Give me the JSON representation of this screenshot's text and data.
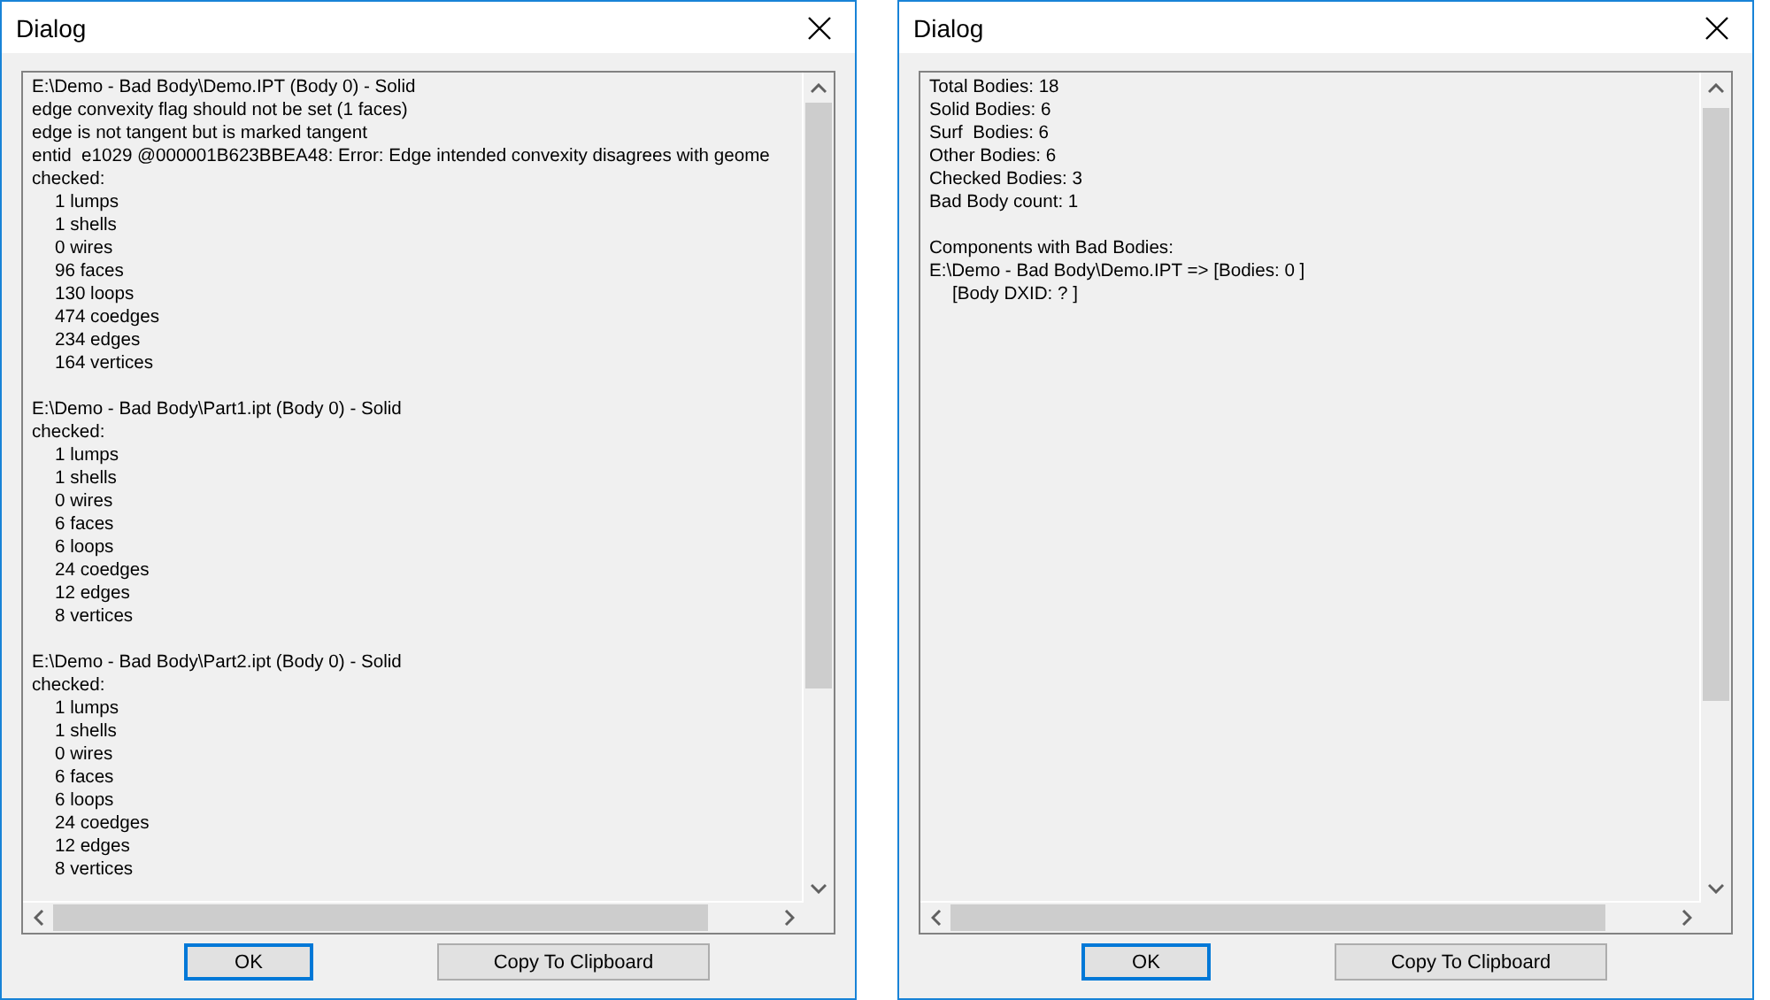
{
  "dialogs": [
    {
      "title": "Dialog",
      "blocks": [
        {
          "lines": [
            {
              "text": "E:\\Demo - Bad Body\\Demo.IPT (Body 0) - Solid"
            },
            {
              "text": "edge convexity flag should not be set (1 faces)"
            },
            {
              "text": "edge is not tangent but is marked tangent"
            },
            {
              "text": "entid  e1029 @000001B623BBEA48: Error: Edge intended convexity disagrees with geome"
            },
            {
              "text": "checked:",
              "children": [
                {
                  "text": "1 lumps"
                },
                {
                  "text": "1 shells"
                },
                {
                  "text": "0 wires"
                },
                {
                  "text": "96 faces"
                },
                {
                  "text": "130 loops"
                },
                {
                  "text": "474 coedges"
                },
                {
                  "text": "234 edges"
                },
                {
                  "text": "164 vertices"
                }
              ]
            }
          ]
        },
        {
          "lines": [
            {
              "text": "E:\\Demo - Bad Body\\Part1.ipt (Body 0) - Solid"
            },
            {
              "text": "checked:",
              "children": [
                {
                  "text": "1 lumps"
                },
                {
                  "text": "1 shells"
                },
                {
                  "text": "0 wires"
                },
                {
                  "text": "6 faces"
                },
                {
                  "text": "6 loops"
                },
                {
                  "text": "24 coedges"
                },
                {
                  "text": "12 edges"
                },
                {
                  "text": "8 vertices"
                }
              ]
            }
          ]
        },
        {
          "lines": [
            {
              "text": "E:\\Demo - Bad Body\\Part2.ipt (Body 0) - Solid"
            },
            {
              "text": "checked:",
              "children": [
                {
                  "text": "1 lumps"
                },
                {
                  "text": "1 shells"
                },
                {
                  "text": "0 wires"
                },
                {
                  "text": "6 faces"
                },
                {
                  "text": "6 loops"
                },
                {
                  "text": "24 coedges"
                },
                {
                  "text": "12 edges"
                },
                {
                  "text": "8 vertices"
                }
              ]
            }
          ]
        }
      ],
      "buttons": [
        {
          "label": "OK",
          "selected": true
        },
        {
          "label": "Copy To Clipboard",
          "selected": false
        }
      ]
    },
    {
      "title": "Dialog",
      "blocks": [
        {
          "lines": [
            {
              "text": "Total Bodies: 18"
            },
            {
              "text": "Solid Bodies: 6"
            },
            {
              "text": "Surf  Bodies: 6"
            },
            {
              "text": "Other Bodies: 6"
            },
            {
              "text": "Checked Bodies: 3"
            },
            {
              "text": "Bad Body count: 1"
            }
          ]
        },
        {
          "lines": [
            {
              "text": "Components with Bad Bodies:"
            },
            {
              "text": "E:\\Demo - Bad Body\\Demo.IPT => [Bodies: 0 ]",
              "children": [
                {
                  "text": "[Body DXID: ? ]"
                }
              ]
            }
          ]
        }
      ],
      "buttons": [
        {
          "label": "OK",
          "selected": true
        },
        {
          "label": "Copy To Clipboard",
          "selected": false
        }
      ]
    }
  ]
}
